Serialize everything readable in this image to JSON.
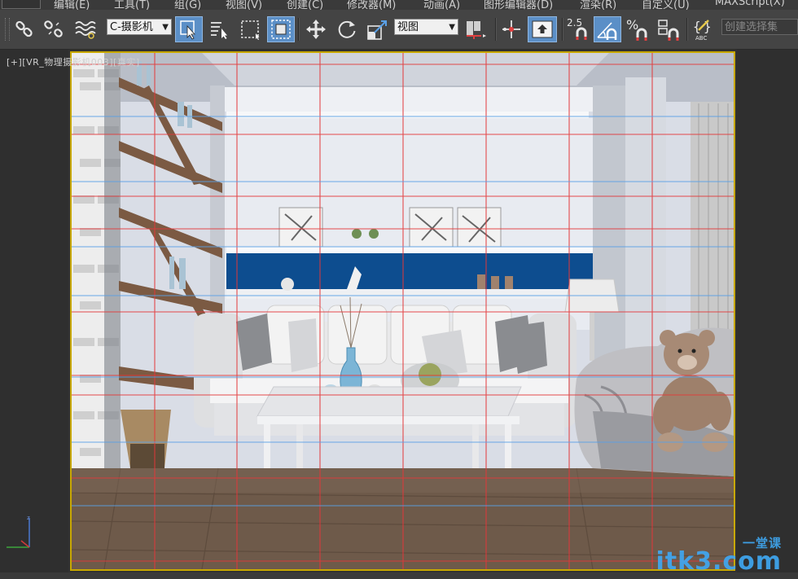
{
  "menubar": {
    "items": [
      {
        "id": "edit",
        "label": "编辑(E)"
      },
      {
        "id": "tools",
        "label": "工具(T)"
      },
      {
        "id": "group",
        "label": "组(G)"
      },
      {
        "id": "views",
        "label": "视图(V)"
      },
      {
        "id": "create",
        "label": "创建(C)"
      },
      {
        "id": "modifiers",
        "label": "修改器(M)"
      },
      {
        "id": "animation",
        "label": "动画(A)"
      },
      {
        "id": "graph-editors",
        "label": "图形编辑器(D)"
      },
      {
        "id": "rendering",
        "label": "渲染(R)"
      },
      {
        "id": "customize",
        "label": "自定义(U)"
      },
      {
        "id": "maxscript",
        "label": "MAXScript(X)"
      }
    ]
  },
  "toolbar": {
    "selection_filter": "C-摄影机",
    "reference_coord": "视图",
    "spinner_snap_value": "2.5",
    "angle_snap_symbol": "%",
    "named_selection_placeholder": "创建选择集"
  },
  "viewport": {
    "label": "[+][VR_物理摄影机003][真实]"
  },
  "watermark": {
    "domain": "itk3.com",
    "cn": "一堂课"
  }
}
